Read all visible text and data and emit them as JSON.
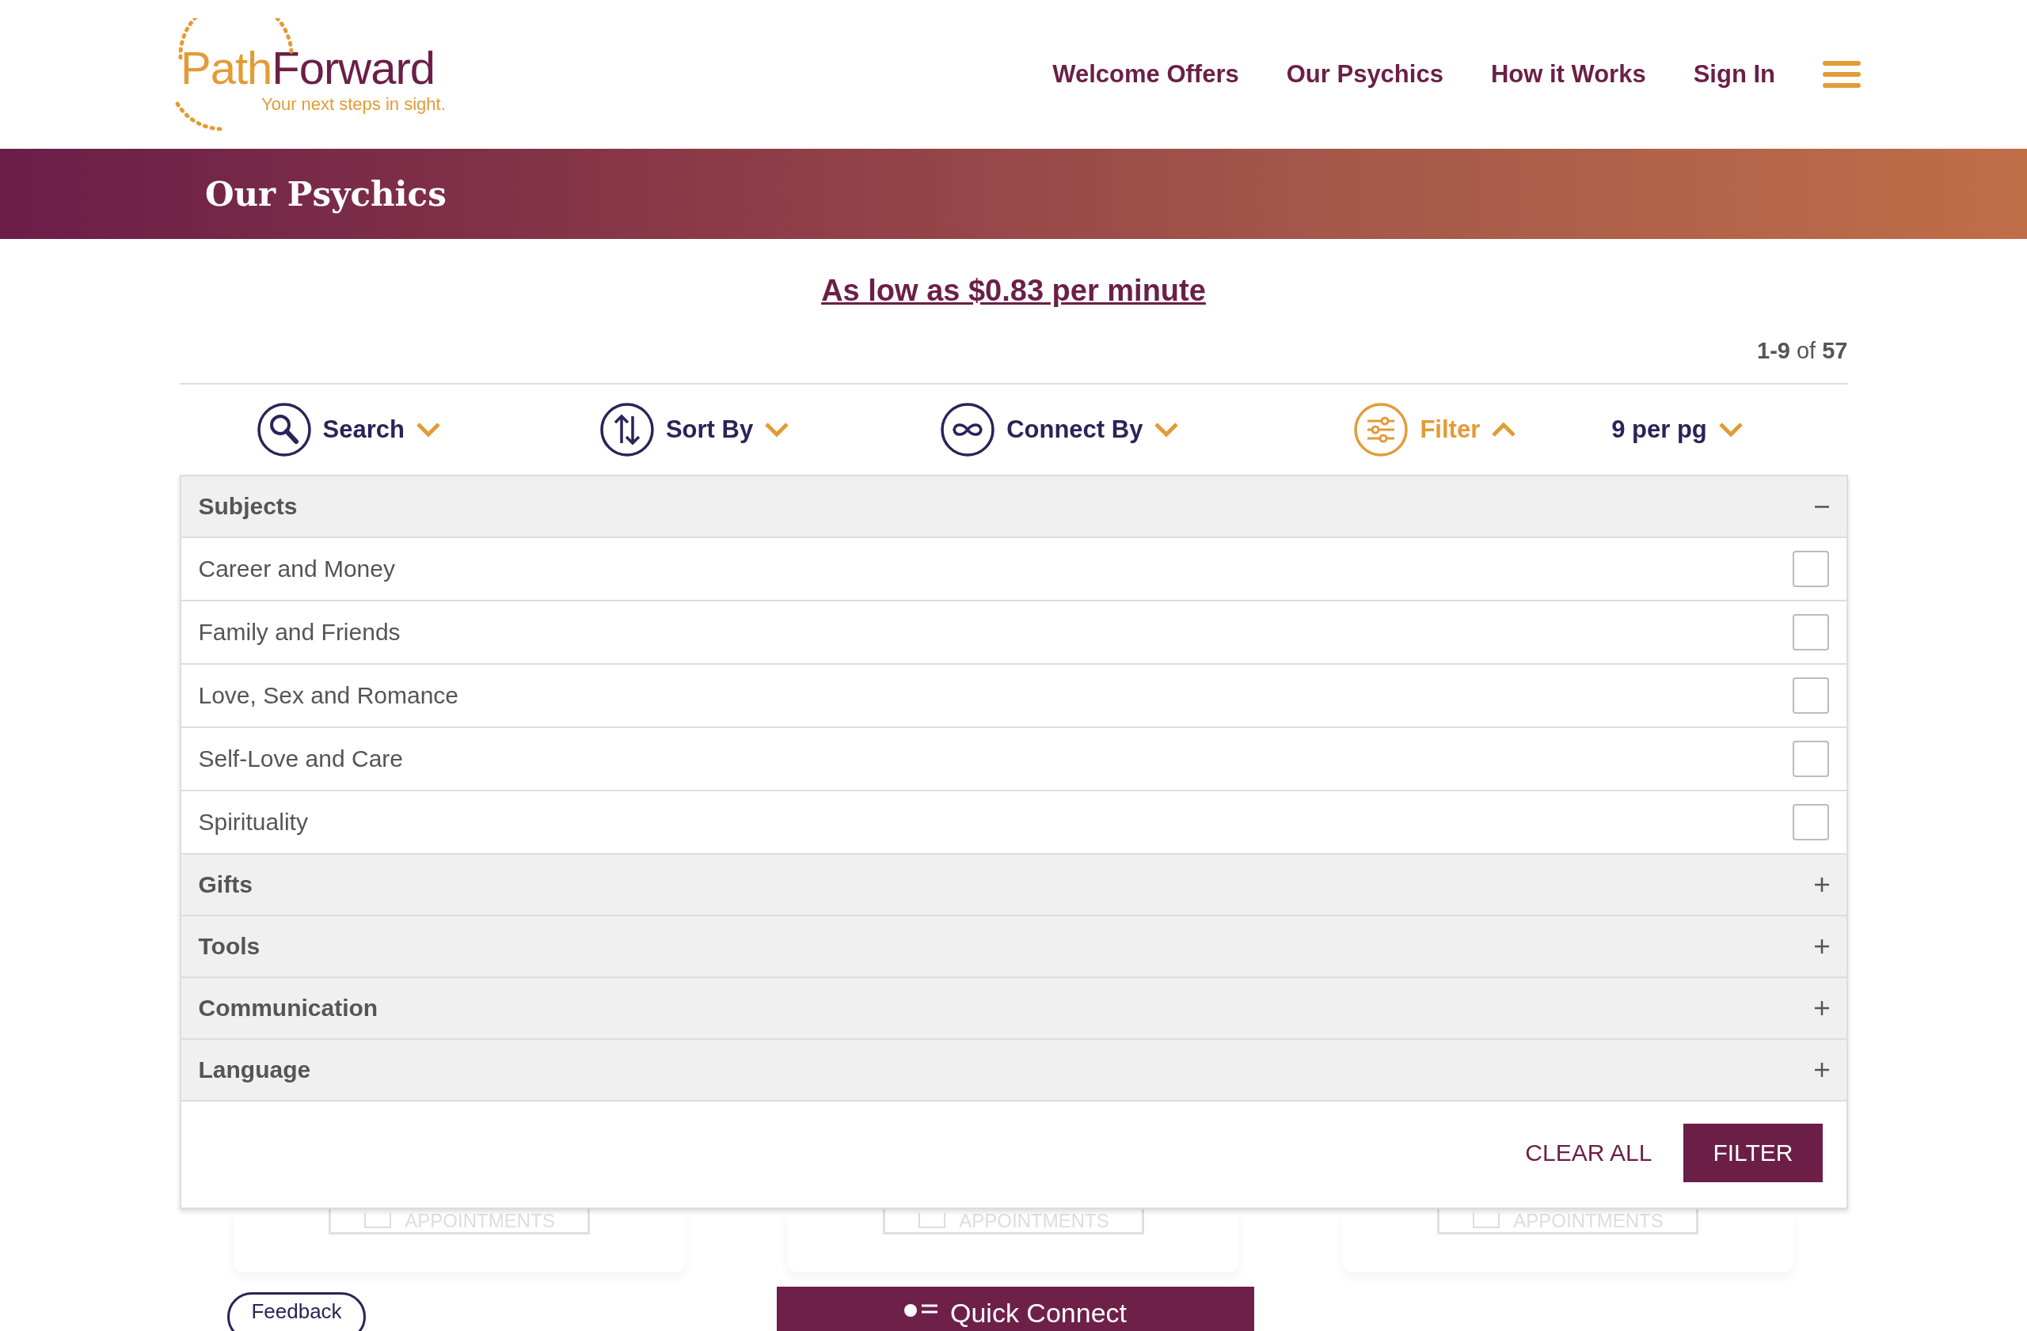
{
  "logo": {
    "name_first": "Path",
    "name_second": "Forward",
    "tagline": "Your next steps in sight."
  },
  "nav": [
    {
      "label": "Welcome Offers"
    },
    {
      "label": "Our Psychics"
    },
    {
      "label": "How it Works"
    },
    {
      "label": "Sign In"
    }
  ],
  "banner": {
    "title": "Our Psychics"
  },
  "promo_link": "As low as $0.83 per minute",
  "result_count": "**1-9** of **57**",
  "toolbar": [
    {
      "kind": "search",
      "label": "Search",
      "expanded": false
    },
    {
      "kind": "sort",
      "label": "Sort By",
      "expanded": false
    },
    {
      "kind": "connect",
      "label": "Connect By",
      "expanded": false
    },
    {
      "kind": "filter",
      "label": "Filter",
      "expanded": true
    },
    {
      "kind": "none",
      "label": "9 per pg",
      "expanded": false
    }
  ],
  "filter_sections": [
    {
      "title": "Subjects",
      "expanded": true,
      "options": [
        {
          "label": "Career and Money",
          "checked": false
        },
        {
          "label": "Family and Friends",
          "checked": false
        },
        {
          "label": "Love, Sex and Romance",
          "checked": false
        },
        {
          "label": "Self-Love and Care",
          "checked": false
        },
        {
          "label": "Spirituality",
          "checked": false
        }
      ]
    },
    {
      "title": "Gifts",
      "expanded": false
    },
    {
      "title": "Tools",
      "expanded": false
    },
    {
      "title": "Communication",
      "expanded": false
    },
    {
      "title": "Language",
      "expanded": false
    }
  ],
  "panel_buttons": {
    "clear": "CLEAR ALL",
    "apply": "FILTER"
  },
  "cards": [
    {
      "button": "APPOINTMENTS"
    },
    {
      "button": "APPOINTMENTS"
    },
    {
      "button": "APPOINTMENTS"
    }
  ],
  "feedback": "Feedback",
  "quick_connect": "Quick Connect"
}
